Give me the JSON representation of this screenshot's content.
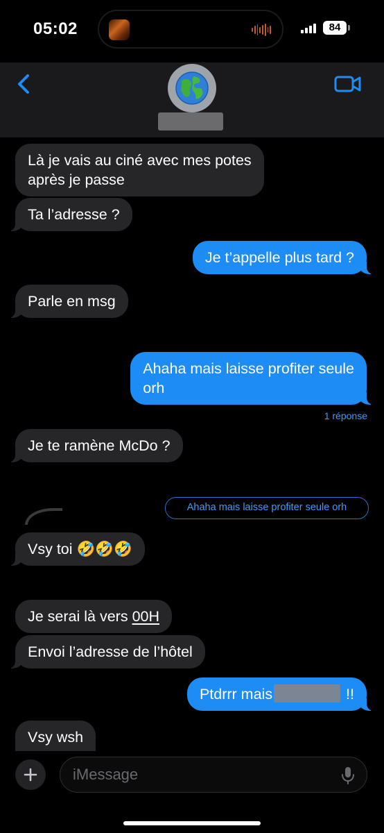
{
  "status_bar": {
    "time": "05:02",
    "battery": "84"
  },
  "header": {
    "back_icon": "chevron-left-icon",
    "video_icon": "video-camera-icon",
    "avatar_icon": "globe-icon"
  },
  "messages": [
    {
      "dir": "in",
      "lines": [
        "Là je vais au ciné avec mes potes",
        "après je passe"
      ]
    },
    {
      "dir": "in",
      "text": "Ta l’adresse ?"
    },
    {
      "dir": "out",
      "text": "Je t’appelle plus tard ?"
    },
    {
      "dir": "in",
      "text": "Parle en msg"
    },
    {
      "dir": "out",
      "lines": [
        "Ahaha mais laisse profiter seule",
        "orh"
      ]
    },
    {
      "dir": "in",
      "text": "Je te ramène McDo ?"
    },
    {
      "dir": "in",
      "text": "Vsy toi 🤣🤣🤣"
    },
    {
      "dir": "in",
      "prefix": "Je serai là vers ",
      "link": "00H"
    },
    {
      "dir": "in",
      "text": "Envoi l’adresse de l’hôtel"
    },
    {
      "dir": "out",
      "prefix": "Ptdrrr mais",
      "suffix": " !!"
    },
    {
      "dir": "in",
      "text": "Vsy wsh"
    }
  ],
  "reply_count": "1 réponse",
  "quoted_reply": "Ahaha mais laisse profiter seule orh",
  "input": {
    "placeholder": "iMessage",
    "plus_icon": "plus-icon",
    "mic_icon": "microphone-icon"
  },
  "colors": {
    "outgoing": "#1e8cf5",
    "incoming": "#262629",
    "accent": "#3d9bff",
    "background": "#000000"
  }
}
